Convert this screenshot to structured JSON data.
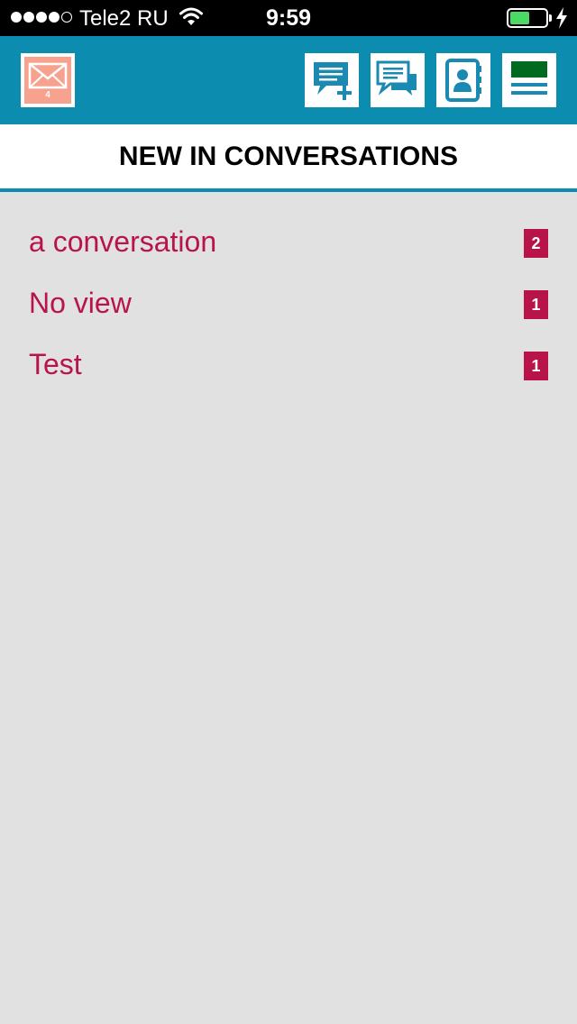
{
  "status_bar": {
    "carrier": "Tele2 RU",
    "time": "9:59",
    "battery_level": 0.55,
    "battery_color": "#4cd964"
  },
  "header": {
    "background": "#0c8db0",
    "mail_count": "4",
    "icons": [
      "mail-icon",
      "new-conversation-icon",
      "conversations-icon",
      "contacts-icon",
      "menu-icon"
    ]
  },
  "page": {
    "title": "NEW IN CONVERSATIONS"
  },
  "conversations": [
    {
      "name": "a conversation",
      "count": "2"
    },
    {
      "name": "No view",
      "count": "1"
    },
    {
      "name": "Test",
      "count": "1"
    }
  ],
  "colors": {
    "accent": "#b8144a",
    "background": "#e1e1e1"
  }
}
